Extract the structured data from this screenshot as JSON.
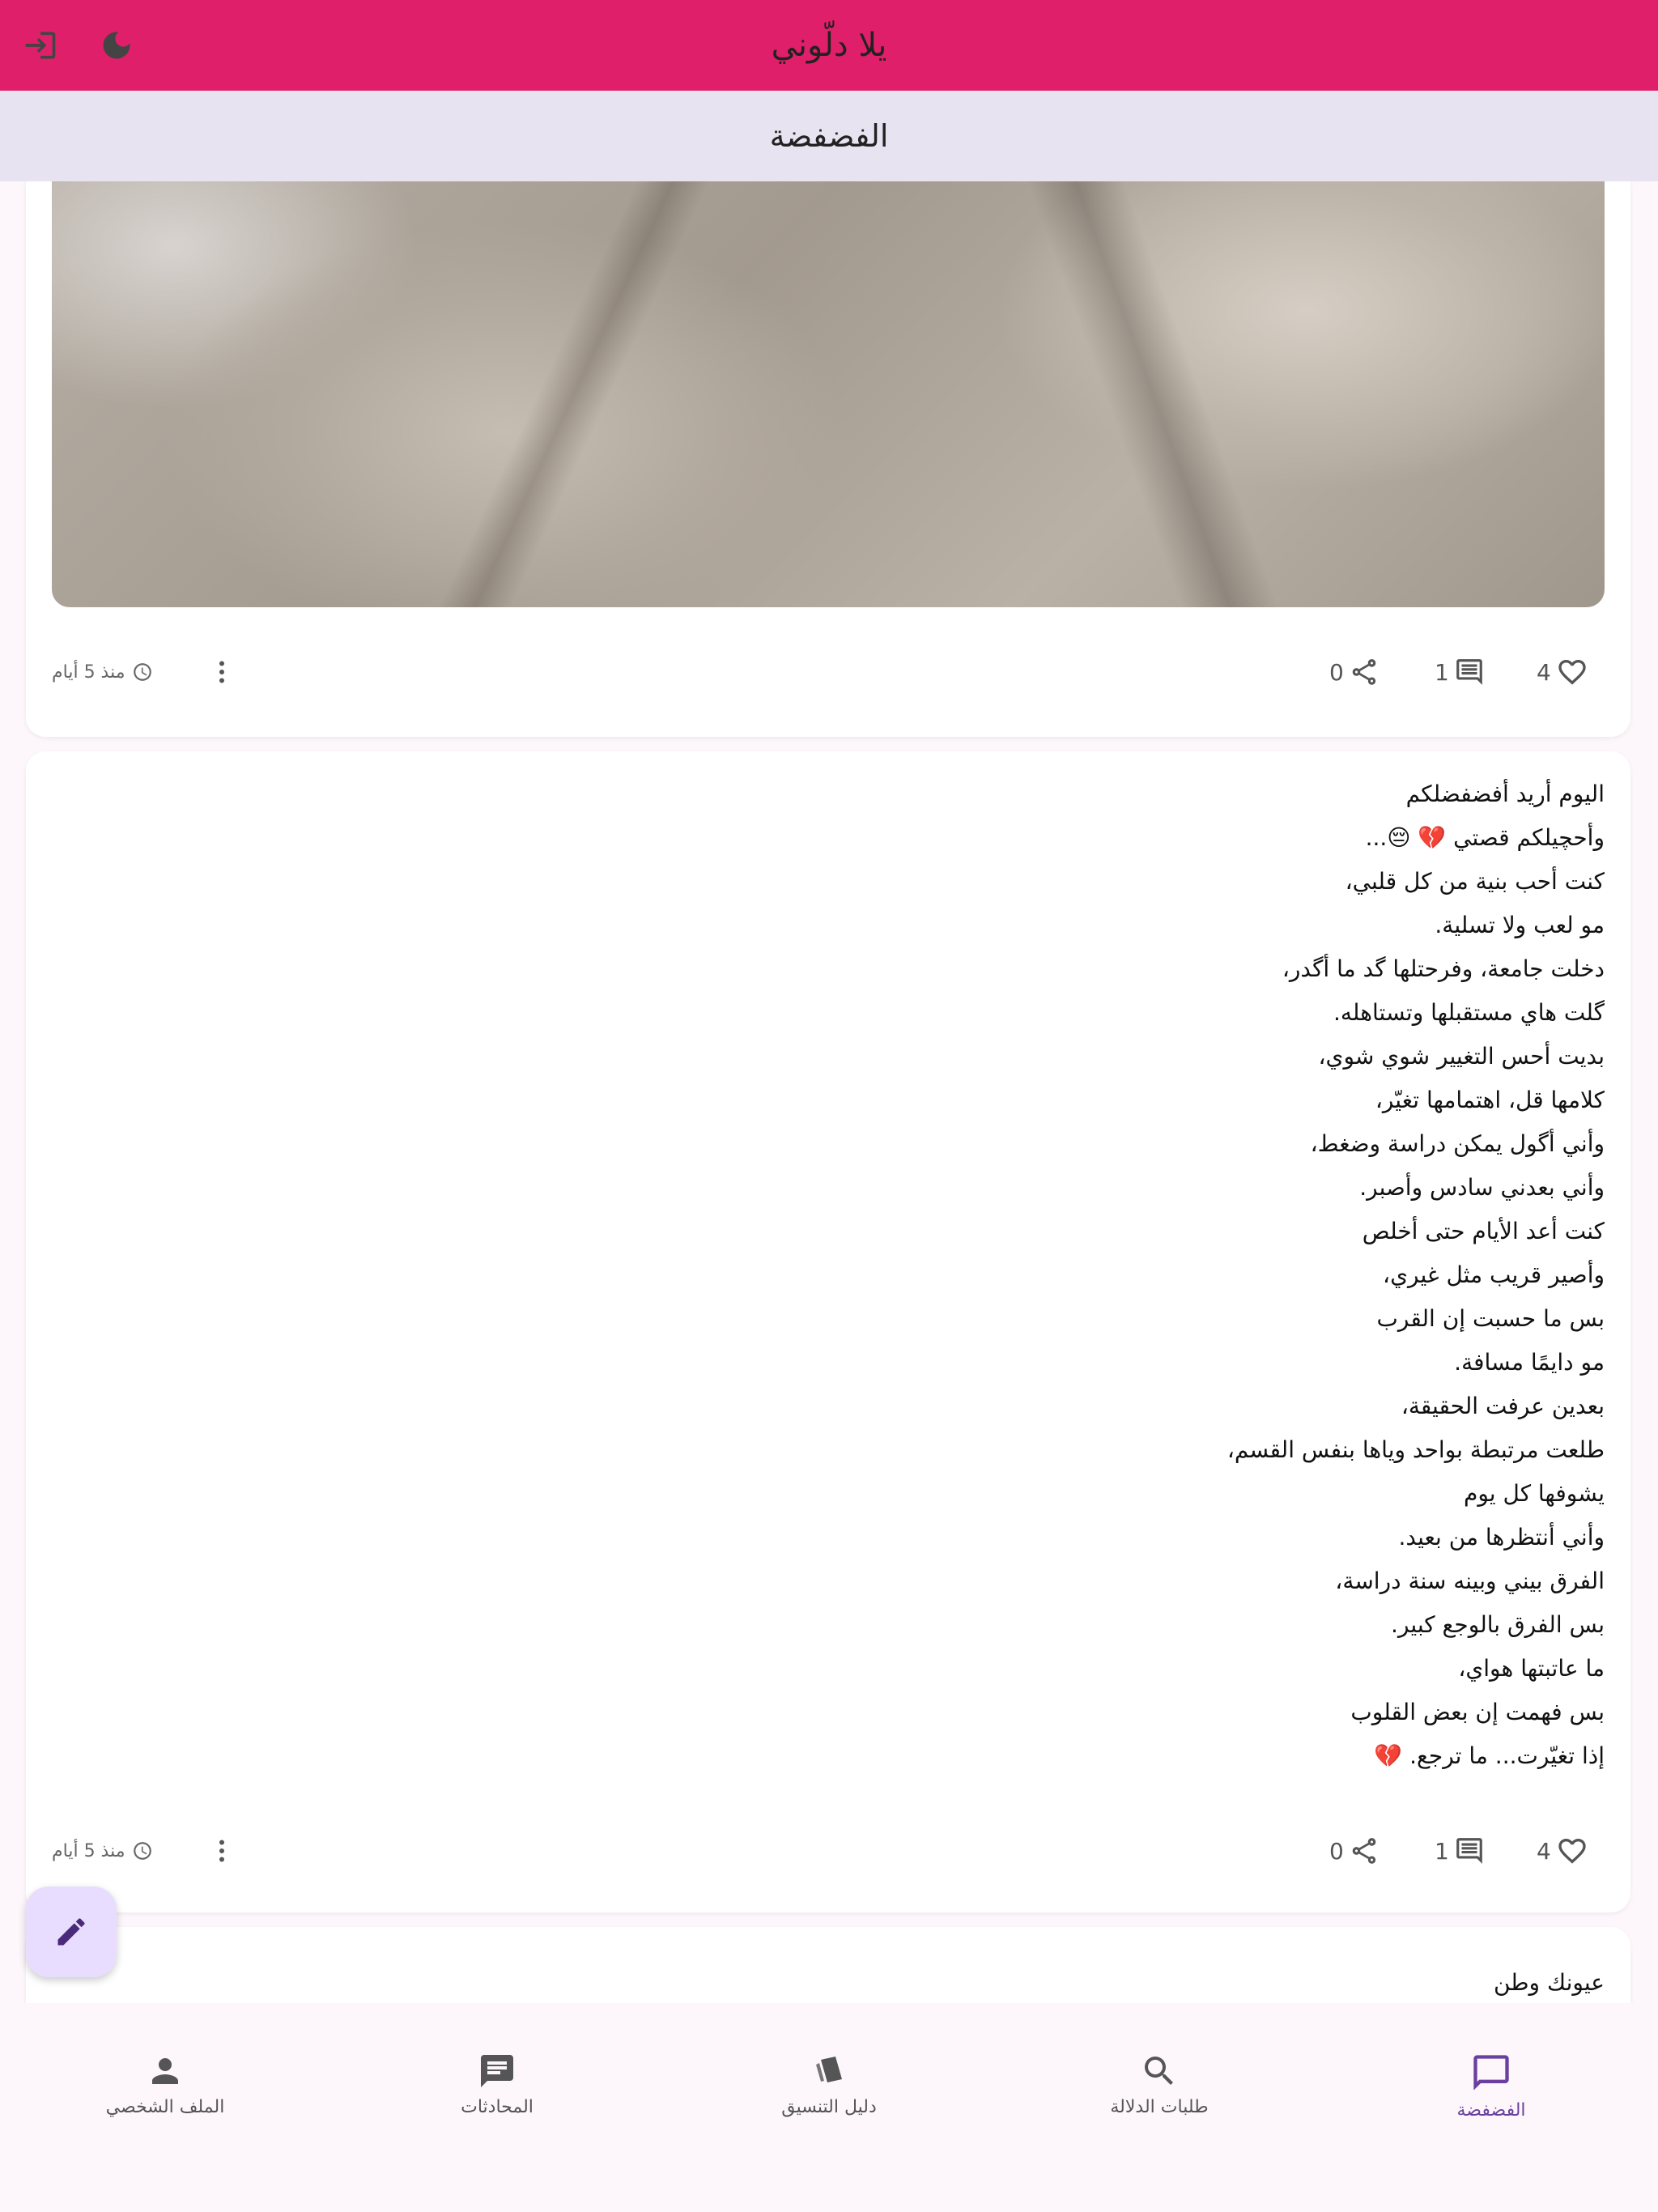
{
  "app": {
    "title": "يلا دلّوني"
  },
  "section": {
    "title": "الفضفضة"
  },
  "posts": [
    {
      "likes": "4",
      "comments": "1",
      "shares": "0",
      "time": "منذ 5 أيام"
    },
    {
      "lines": [
        "اليوم أريد أفضفضلكم",
        "وأحچيلكم قصتي 💔 😔...",
        "كنت أحب بنية من كل قلبي،",
        "مو لعب ولا تسلية.",
        "دخلت جامعة، وفرحتلها گد ما أگدر،",
        "گلت هاي مستقبلها وتستاهله.",
        "بديت أحس التغيير شوي شوي،",
        "كلامها قل، اهتمامها تغيّر،",
        "وأني أگول يمكن دراسة وضغط،",
        "وأني بعدني سادس وأصبر.",
        "كنت أعد الأيام حتى أخلص",
        "وأصير قريب مثل غيري،",
        "بس ما حسبت إن القرب",
        "مو دايمًا مسافة.",
        "بعدين عرفت الحقيقة،",
        "طلعت مرتبطة بواحد وياها بنفس القسم،",
        "يشوفها كل يوم",
        "وأني أنتظرها من بعيد.",
        "الفرق بيني وبينه سنة دراسة،",
        "بس الفرق بالوجع كبير.",
        "ما عاتبتها هواي،",
        "بس فهمت إن بعض القلوب",
        "إذا تغيّرت... ما ترجع. 💔"
      ],
      "likes": "4",
      "comments": "1",
      "shares": "0",
      "time": "منذ 5 أيام"
    },
    {
      "lines": [
        "عيونك وطن"
      ]
    }
  ],
  "nav": {
    "items": [
      {
        "label": "الفضفضة",
        "icon": "chat-bubble-icon",
        "active": true
      },
      {
        "label": "طلبات الدلالة",
        "icon": "search-icon",
        "active": false
      },
      {
        "label": "دليل التنسيق",
        "icon": "cards-icon",
        "active": false
      },
      {
        "label": "المحادثات",
        "icon": "message-icon",
        "active": false
      },
      {
        "label": "الملف الشخصي",
        "icon": "person-icon",
        "active": false
      }
    ]
  },
  "colors": {
    "appbar": "#e01f6a",
    "subbar": "#e7e3f0",
    "fab": "#e9ddff",
    "accent": "#6a3fa0"
  }
}
